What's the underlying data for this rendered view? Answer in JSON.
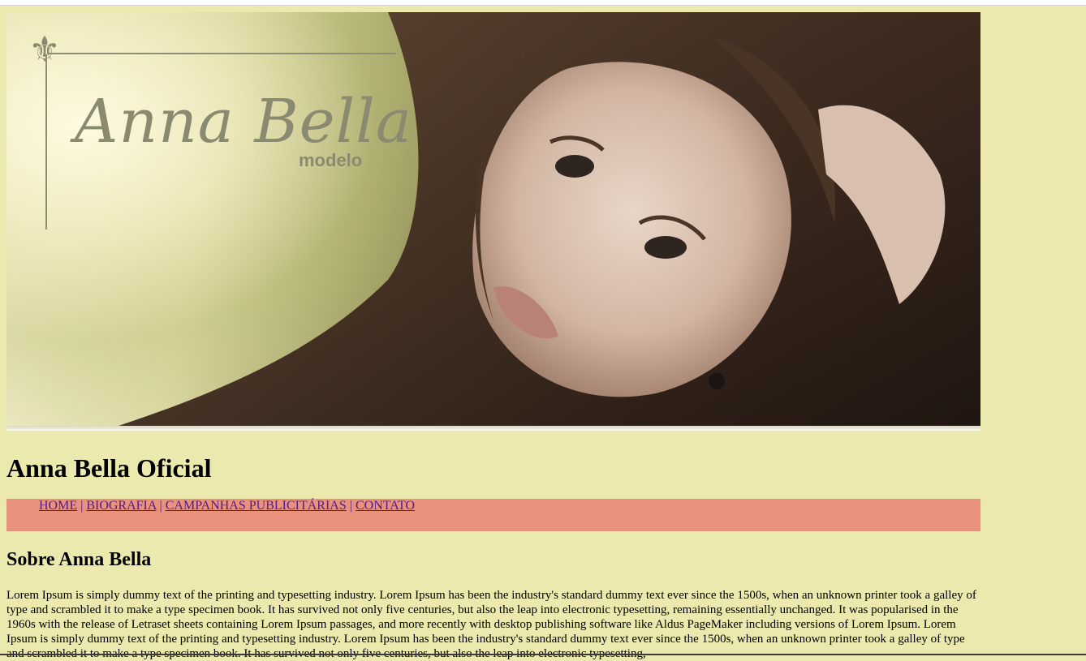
{
  "banner": {
    "logo_name": "Anna Bella",
    "logo_sub": "modelo",
    "logo_emblem": "fleur-de-lis-icon"
  },
  "site_title": "Anna Bella Oficial",
  "nav": {
    "items": [
      "HOME",
      "BIOGRAFIA",
      "CAMPANHAS PUBLICITÁRIAS",
      "CONTATO"
    ],
    "separator": "|"
  },
  "section_title": "Sobre Anna Bella",
  "bio_text": "Lorem Ipsum is simply dummy text of the printing and typesetting industry. Lorem Ipsum has been the industry's standard dummy text ever since the 1500s, when an unknown printer took a galley of type and scrambled it to make a type specimen book. It has survived not only five centuries, but also the leap into electronic typesetting, remaining essentially unchanged. It was popularised in the 1960s with the release of Letraset sheets containing Lorem Ipsum passages, and more recently with desktop publishing software like Aldus PageMaker including versions of Lorem Ipsum. Lorem Ipsum is simply dummy text of the printing and typesetting industry. Lorem Ipsum has been the industry's standard dummy text ever since the 1500s, when an unknown printer took a galley of type and scrambled it to make a type specimen book. It has survived not only five centuries, but also the leap into electronic typesetting,",
  "colors": {
    "page_background": "#ebe9ad",
    "nav_background": "#e8927c",
    "link": "#551a8b"
  }
}
